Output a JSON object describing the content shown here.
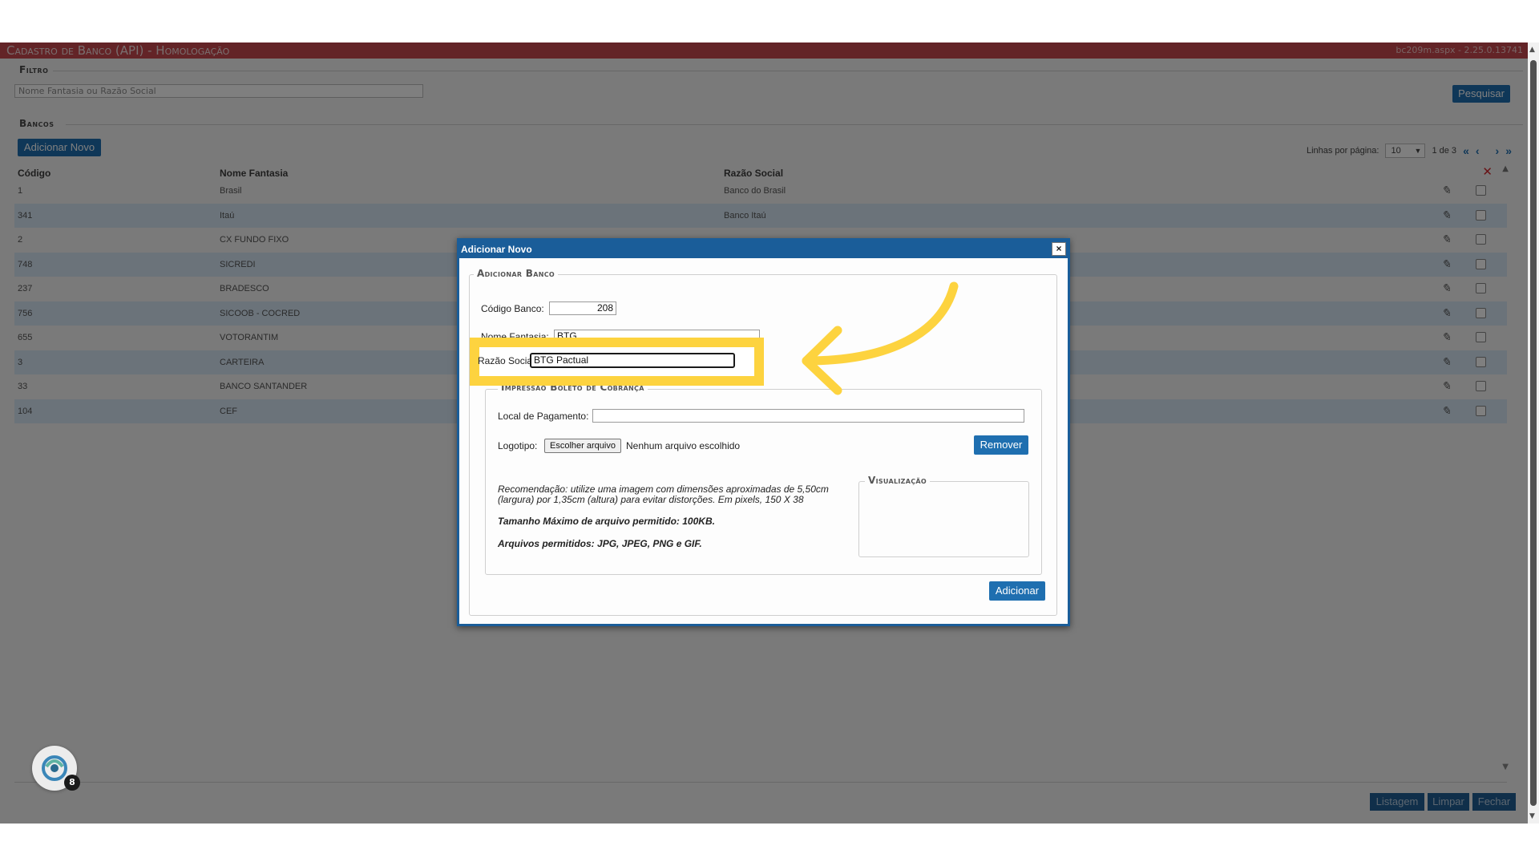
{
  "app": {
    "title": "Cadastro de Banco (API)  - Homologação",
    "version": "bc209m.aspx - 2.25.0.13741"
  },
  "filtro": {
    "legend": "Filtro",
    "placeholder": "Nome Fantasia ou Razão Social",
    "search_label": "Pesquisar"
  },
  "bancos": {
    "legend": "Bancos",
    "add_label": "Adicionar Novo",
    "rows_per_page_label": "Linhas por página:",
    "rows_per_page_value": "10",
    "page_info": "1 de 3",
    "columns": [
      "Código",
      "Nome Fantasia",
      "Razão Social"
    ],
    "rows": [
      {
        "codigo": "1",
        "nome": "Brasil",
        "razao": "Banco do Brasil"
      },
      {
        "codigo": "341",
        "nome": "Itaú",
        "razao": "Banco Itaú"
      },
      {
        "codigo": "2",
        "nome": "CX FUNDO FIXO",
        "razao": ""
      },
      {
        "codigo": "748",
        "nome": "SICREDI",
        "razao": ""
      },
      {
        "codigo": "237",
        "nome": "BRADESCO",
        "razao": ""
      },
      {
        "codigo": "756",
        "nome": "SICOOB - COCRED",
        "razao": ""
      },
      {
        "codigo": "655",
        "nome": "VOTORANTIM",
        "razao": ""
      },
      {
        "codigo": "3",
        "nome": "CARTEIRA",
        "razao": ""
      },
      {
        "codigo": "33",
        "nome": "BANCO SANTANDER",
        "razao": ""
      },
      {
        "codigo": "104",
        "nome": "CEF",
        "razao": ""
      }
    ]
  },
  "footer": {
    "listagem": "Listagem",
    "limpar": "Limpar",
    "fechar": "Fechar"
  },
  "chat": {
    "badge": "8"
  },
  "dialog": {
    "title": "Adicionar Novo",
    "close": "×",
    "legend": "Adicionar Banco",
    "codigo_label": "Código Banco:",
    "codigo_value": "208",
    "nome_label": "Nome Fantasia:",
    "nome_value": "BTG",
    "razao_label": "Razão Social:",
    "razao_value": "BTG Pactual",
    "impressao_legend": "Impressão Boleto de Cobrança",
    "local_label": "Local de Pagamento:",
    "local_value": "",
    "logo_label": "Logotipo:",
    "file_button": "Escolher arquivo",
    "file_status": "Nenhum arquivo escolhido",
    "remover_label": "Remover",
    "recomendacao": "Recomendação: utilize uma imagem com dimensões aproximadas de 5,50cm (largura) por 1,35cm (altura) para evitar distorções. Em pixels, 150 X 38",
    "tamanho": "Tamanho Máximo de arquivo permitido: 100KB.",
    "arquivos": "Arquivos permitidos: JPG, JPEG, PNG e GIF.",
    "visualizacao_legend": "Visualização",
    "adicionar_label": "Adicionar"
  },
  "colors": {
    "title_bar": "#c7484f",
    "primary": "#1f6fb0",
    "dialog_header": "#1a5d99",
    "highlight": "#fdd33f",
    "row_alt": "#d6e6f5"
  },
  "icons": [
    "pencil-icon",
    "close-x-icon",
    "first-page-icon",
    "prev-page-icon",
    "next-page-icon",
    "last-page-icon",
    "chat-icon",
    "curved-arrow-icon"
  ]
}
